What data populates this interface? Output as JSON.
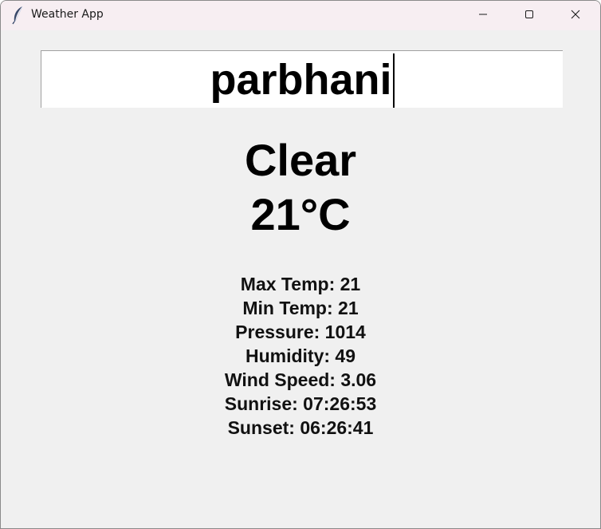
{
  "window": {
    "title": "Weather App",
    "icon": "feather-icon",
    "controls": {
      "minimize": "minimize-icon",
      "maximize": "maximize-icon",
      "close": "close-icon"
    }
  },
  "search": {
    "value": "parbhani"
  },
  "weather": {
    "condition": "Clear",
    "temperature": "21°C"
  },
  "details": [
    "Max Temp: 21",
    "Min Temp: 21",
    "Pressure: 1014",
    "Humidity: 49",
    "Wind Speed: 3.06",
    "Sunrise: 07:26:53",
    "Sunset: 06:26:41"
  ]
}
